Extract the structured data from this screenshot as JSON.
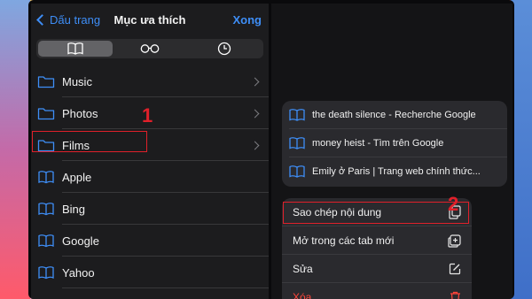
{
  "nav": {
    "back_label": "Dấu trang",
    "title": "Mục ưa thích",
    "done_label": "Xong"
  },
  "segments": [
    {
      "icon": "book-icon",
      "active": true
    },
    {
      "icon": "glasses-icon",
      "active": false
    },
    {
      "icon": "clock-icon",
      "active": false
    }
  ],
  "bookmarks": {
    "items": [
      {
        "label": "Music",
        "icon": "folder-icon"
      },
      {
        "label": "Photos",
        "icon": "folder-icon"
      },
      {
        "label": "Films",
        "icon": "folder-icon"
      },
      {
        "label": "Apple",
        "icon": "book-icon"
      },
      {
        "label": "Bing",
        "icon": "book-icon"
      },
      {
        "label": "Google",
        "icon": "book-icon"
      },
      {
        "label": "Yahoo",
        "icon": "book-icon"
      }
    ]
  },
  "annotations": {
    "step1": "1",
    "step2": "2"
  },
  "suggestions": {
    "items": [
      {
        "label": "the death silence - Recherche Google"
      },
      {
        "label": "money heist - Tìm trên Google"
      },
      {
        "label": "Emily ở Paris | Trang web chính thức..."
      }
    ]
  },
  "context_menu": {
    "items": [
      {
        "label": "Sao chép nội dung",
        "icon": "copy-icon"
      },
      {
        "label": "Mở trong các tab mới",
        "icon": "new-tab-icon"
      },
      {
        "label": "Sửa",
        "icon": "edit-icon"
      },
      {
        "label": "Xóa",
        "icon": "trash-icon",
        "danger": true
      }
    ]
  },
  "colors": {
    "accent": "#3e8ef7",
    "annotation": "#e0202a",
    "destructive": "#ff453a"
  }
}
